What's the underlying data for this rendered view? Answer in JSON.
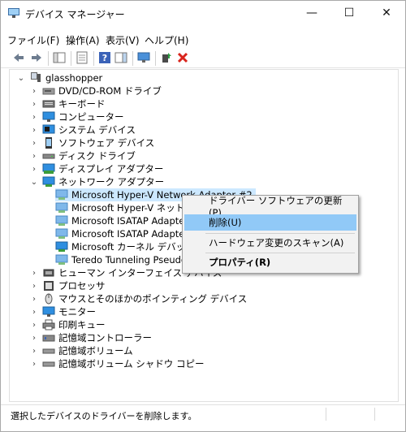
{
  "window": {
    "title": "デバイス マネージャー",
    "minimize": "—",
    "maximize": "☐",
    "close": "✕"
  },
  "menu": [
    "ファイル(F)",
    "操作(A)",
    "表示(V)",
    "ヘルプ(H)"
  ],
  "tree": {
    "root": "glasshopper",
    "categories": [
      "DVD/CD-ROM ドライブ",
      "キーボード",
      "コンピューター",
      "システム デバイス",
      "ソフトウェア デバイス",
      "ディスク ドライブ",
      "ディスプレイ アダプター",
      "ネットワーク アダプター"
    ],
    "network_children": [
      "Microsoft Hyper-V Network Adapter #2",
      "Microsoft Hyper-V ネットワーク",
      "Microsoft ISATAP Adapter",
      "Microsoft ISATAP Adapter #2",
      "Microsoft カーネル デバッグ ネット",
      "Teredo Tunneling Pseudo-Inte"
    ],
    "categories_after": [
      "ヒューマン インターフェイス デバイス",
      "プロセッサ",
      "マウスとそのほかのポインティング デバイス",
      "モニター",
      "印刷キュー",
      "記憶域コントローラー",
      "記憶域ボリューム",
      "記憶域ボリューム シャドウ コピー"
    ]
  },
  "context_menu": {
    "update_driver": "ドライバー ソフトウェアの更新(P)...",
    "uninstall": "削除(U)",
    "scan": "ハードウェア変更のスキャン(A)",
    "properties": "プロパティ(R)"
  },
  "status": "選択したデバイスのドライバーを削除します。"
}
